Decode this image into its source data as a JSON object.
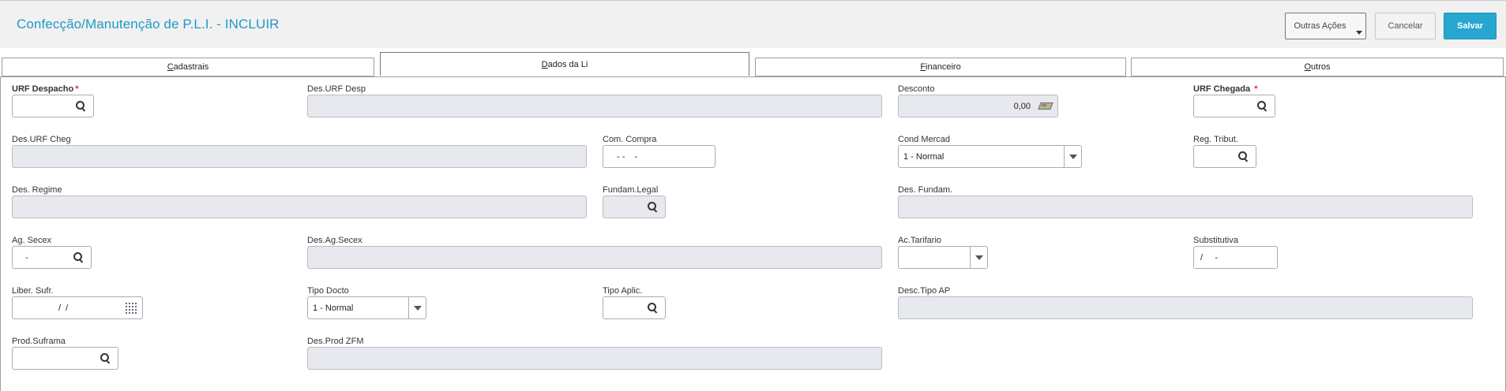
{
  "header": {
    "title": "Confecção/Manutenção de P.L.I. - INCLUIR",
    "actions": {
      "other_actions": "Outras Ações",
      "cancel": "Cancelar",
      "save": "Salvar"
    }
  },
  "tabs": [
    {
      "label": "Cadastrais",
      "accel": "C",
      "rest": "adastrais",
      "active": false
    },
    {
      "label": "Dados da Li",
      "accel": "D",
      "rest": "ados da Li",
      "active": true
    },
    {
      "label": "Financeiro",
      "accel": "F",
      "rest": "inanceiro",
      "active": false
    },
    {
      "label": "Outros",
      "accel": "O",
      "rest": "utros",
      "active": false
    }
  ],
  "form": {
    "urf_despacho": {
      "label": "URF Despacho",
      "required_mark": "*",
      "value": ""
    },
    "des_urf_desp": {
      "label": "Des.URF Desp",
      "value": ""
    },
    "desconto": {
      "label": "Desconto",
      "value": "0,00"
    },
    "urf_chegada": {
      "label": "URF Chegada",
      "required_mark": "*",
      "value": ""
    },
    "des_urf_cheg": {
      "label": "Des.URF Cheg",
      "value": ""
    },
    "com_compra": {
      "label": "Com. Compra",
      "value": "- -    -"
    },
    "cond_mercad": {
      "label": "Cond Mercad",
      "value": "1 - Normal"
    },
    "reg_tribut": {
      "label": "Reg. Tribut.",
      "value": ""
    },
    "des_regime": {
      "label": "Des. Regime",
      "value": ""
    },
    "fundam_legal": {
      "label": "Fundam.Legal",
      "value": ""
    },
    "des_fundam": {
      "label": "Des. Fundam.",
      "value": ""
    },
    "ag_secex": {
      "label": "Ag. Secex",
      "value": "  -"
    },
    "des_ag_secex": {
      "label": "Des.Ag.Secex",
      "value": ""
    },
    "ac_tarifario": {
      "label": "Ac.Tarifario",
      "value": ""
    },
    "substitutiva": {
      "label": "Substitutiva",
      "value": "/     -"
    },
    "liber_sufr": {
      "label": "Liber. Sufr.",
      "value": "/  /"
    },
    "tipo_docto": {
      "label": "Tipo Docto",
      "value": "1 - Normal"
    },
    "tipo_aplic": {
      "label": "Tipo Aplic.",
      "value": ""
    },
    "desc_tipo_ap": {
      "label": "Desc.Tipo AP",
      "value": ""
    },
    "prod_suframa": {
      "label": "Prod.Suframa",
      "value": ""
    },
    "des_prod_zfm": {
      "label": "Des.Prod ZFM",
      "value": ""
    }
  },
  "icons": {
    "lookup": "search-icon",
    "currency": "money-icon",
    "date": "calendar-icon",
    "dropdown": "chevron-down-icon"
  },
  "colors": {
    "title": "#1f9ac7",
    "save_button": "#27a7cf",
    "required": "#e0242c",
    "readonly_field": "#e7e9ee"
  }
}
